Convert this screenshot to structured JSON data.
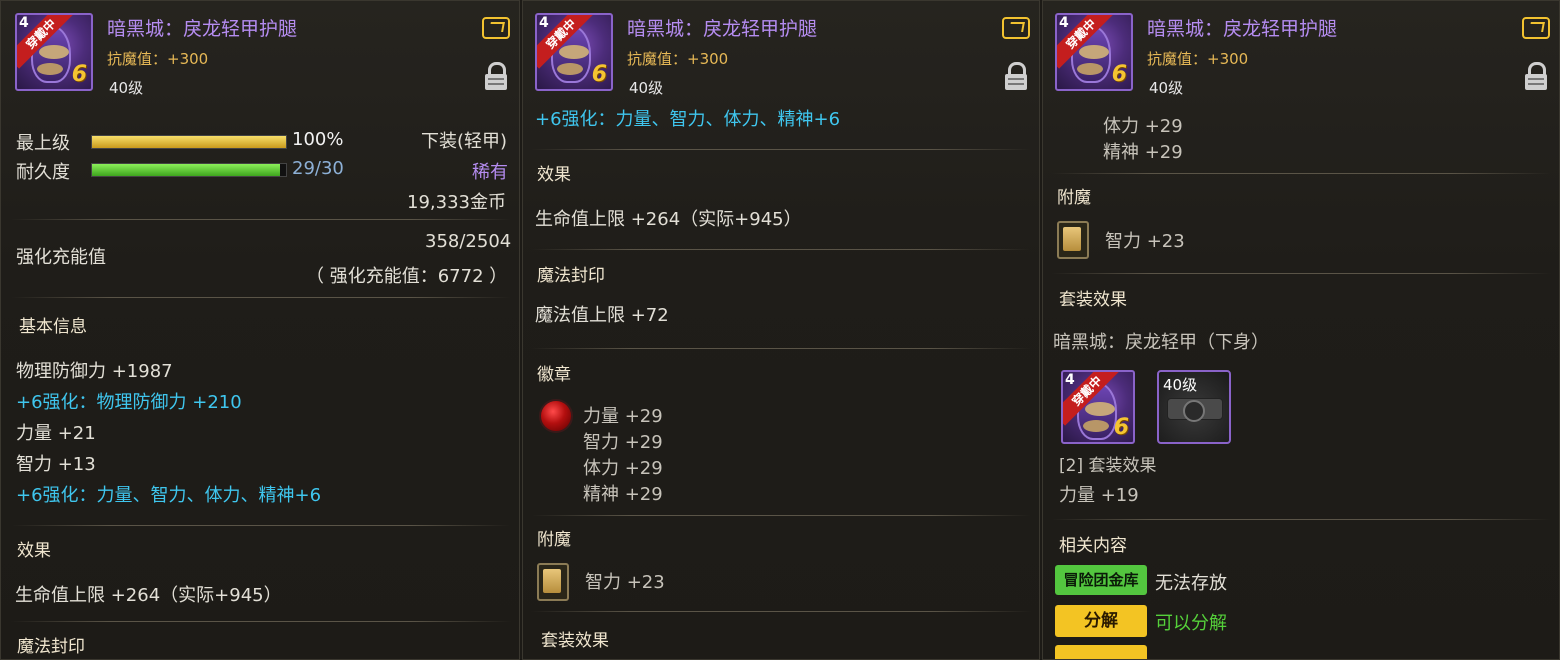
{
  "header": {
    "item_name": "暗黑城：戾龙轻甲护腿",
    "magic_resist": "抗魔值：+300",
    "level": "40级",
    "badge_equipped": "穿戴中",
    "badge_level_digit": "4",
    "enhance_level_digit": "6"
  },
  "panel1": {
    "grade_label": "最上级",
    "grade_value": "100%",
    "grade_fill": 1.0,
    "durability_label": "耐久度",
    "durability_value": "29/30",
    "durability_fill": 0.967,
    "slot_type": "下装(轻甲)",
    "rarity": "稀有",
    "price": "19,333金币",
    "charge_label": "强化充能值",
    "charge_value": "358/2504",
    "charge_total": "（ 强化充能值：6772 ）",
    "basic_title": "基本信息",
    "stats": [
      "物理防御力 +1987",
      "+6强化：物理防御力 +210",
      "力量 +21",
      "智力 +13",
      "+6强化：力量、智力、体力、精神+6"
    ],
    "effect_title": "效果",
    "effect_hp": "生命值上限 +264（实际+945）",
    "seal_title": "魔法封印"
  },
  "panel2": {
    "enhance_line": "+6强化：力量、智力、体力、精神+6",
    "effect_title": "效果",
    "effect_hp": "生命值上限 +264（实际+945）",
    "seal_title": "魔法封印",
    "seal_value": "魔法值上限 +72",
    "emblem_title": "徽章",
    "emblem_stats": [
      "力量 +29",
      "智力 +29",
      "体力 +29",
      "精神 +29"
    ],
    "enchant_title": "附魔",
    "enchant_value": "智力 +23",
    "set_title": "套装效果"
  },
  "panel3": {
    "emblem_stats": [
      "体力 +29",
      "精神 +29"
    ],
    "enchant_title": "附魔",
    "enchant_value": "智力 +23",
    "set_title": "套装效果",
    "set_name": "暗黑城：戾龙轻甲（下身）",
    "set_item2_level": "40级",
    "set_bonus_title": "[2] 套装效果",
    "set_bonus_value": "力量 +19",
    "related_title": "相关内容",
    "vault_button": "冒险团金库",
    "vault_status": "无法存放",
    "disassemble_button": "分解",
    "disassemble_status": "可以分解"
  },
  "colors": {
    "title": "#b58cf0",
    "cyan": "#3fc6ee",
    "gold_bar": "#e9c23a",
    "green_bar": "#5cd03a",
    "rarity": "#b58cf0",
    "green_status": "#55d13a"
  }
}
